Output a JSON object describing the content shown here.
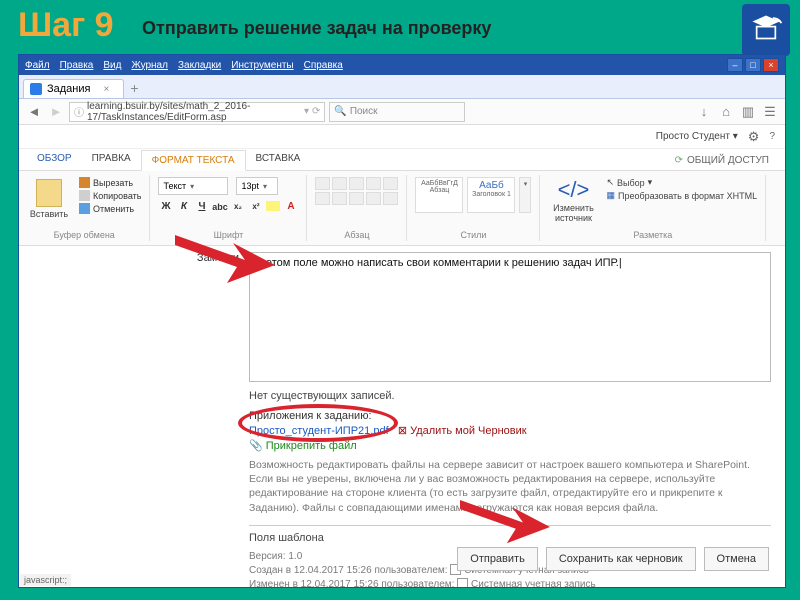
{
  "slide": {
    "step": "Шаг 9",
    "subtitle": "Отправить решение задач на проверку"
  },
  "browser": {
    "menus": [
      "Файл",
      "Правка",
      "Вид",
      "Журнал",
      "Закладки",
      "Инструменты",
      "Справка"
    ],
    "tab_title": "Задания",
    "url": "learning.bsuir.by/sites/math_2_2016-17/TaskInstances/EditForm.asp",
    "search_placeholder": "Поиск",
    "user": "Просто Студент",
    "status": "javascript:;"
  },
  "ribbon": {
    "tabs": {
      "overview": "ОБЗОР",
      "edit": "ПРАВКА",
      "format": "ФОРМАТ ТЕКСТА",
      "insert": "ВСТАВКА"
    },
    "share": "ОБЩИЙ ДОСТУП",
    "clipboard": {
      "paste": "Вставить",
      "cut": "Вырезать",
      "copy": "Копировать",
      "undo": "Отменить",
      "group": "Буфер обмена"
    },
    "font": {
      "body": "Текст",
      "size": "13pt",
      "group": "Шрифт"
    },
    "paragraph": {
      "group": "Абзац"
    },
    "styles": {
      "sample": "АаБбВвГгД",
      "normal": "Абзац",
      "h1": "Заголовок 1",
      "h1_sample": "АаБб",
      "group": "Стили"
    },
    "source": {
      "label": "Изменить источник",
      "group": "Разметка",
      "select": "Выбор",
      "convert": "Преобразовать в формат XHTML"
    }
  },
  "editor": {
    "notes_label": "Заметки",
    "notes_value": "В этом поле можно написать свои комментарии к решению задач ИПР.|",
    "no_records": "Нет существующих записей.",
    "attachments_label": "Приложения к заданию:",
    "attachment_file": "Просто_студент-ИПР21.pdf",
    "delete_draft": "Удалить мой Черновик",
    "attach_file": "Прикрепить файл",
    "help": "Возможность редактировать файлы на сервере зависит от настроек вашего компьютера и SharePoint. Если вы не уверены, включена ли у вас возможность редактирования на сервере, используйте редактирование на стороне клиента (то есть загрузите файл, отредактируйте его и прикрепите к Заданию). Файлы с совпадающими именами загружаются как новая версия файла.",
    "template_fields_label": "Поля шаблона",
    "version_label": "Версия: 1.0",
    "created": "Создан в 12.04.2017 15:26 пользователем:",
    "modified": "Изменен в 12.04.2017 15:26 пользователем:",
    "sys_account": "Системная учетная запись"
  },
  "buttons": {
    "send": "Отправить",
    "draft": "Сохранить как черновик",
    "cancel": "Отмена"
  }
}
